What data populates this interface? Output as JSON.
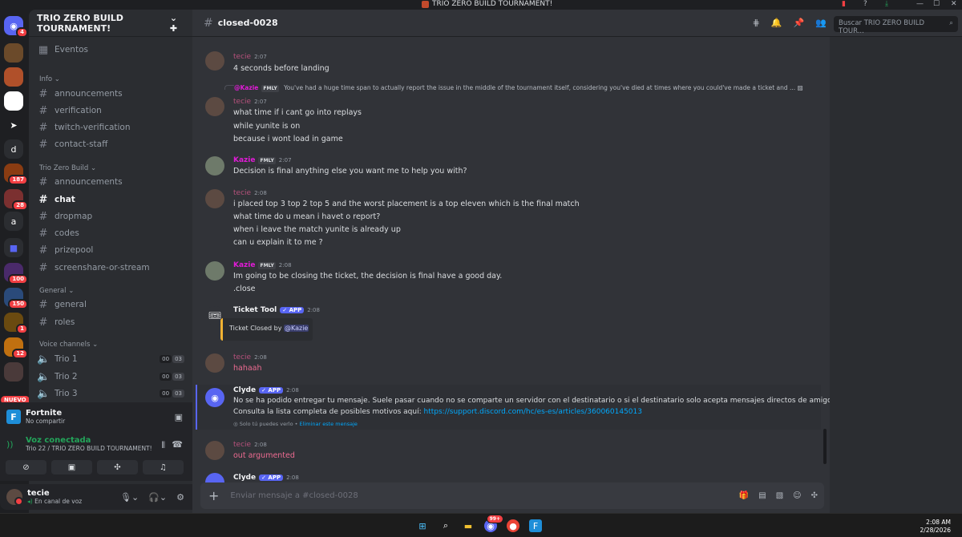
{
  "window": {
    "title": "TRIO ZERO BUILD TOURNAMENT!"
  },
  "rail": {
    "badges": [
      "4",
      "",
      "",
      "",
      "",
      "187",
      "28",
      "",
      "",
      "100",
      "150",
      "1",
      "12",
      "",
      "18"
    ],
    "letters": {
      "d": "d",
      "a": "a"
    },
    "nuevo": "NUEVO"
  },
  "sidebar": {
    "guild_name": "TRIO ZERO BUILD TOURNAMENT!",
    "events_label": "Eventos",
    "categories": {
      "info": "Info",
      "trio_zero_build": "Trio Zero Build",
      "general": "General",
      "voice_channels": "Voice channels"
    },
    "info_channels": [
      "announcements",
      "verification",
      "twitch-verification",
      "contact-staff"
    ],
    "tzb_channels": [
      "announcements",
      "chat",
      "dropmap",
      "codes",
      "prizepool",
      "screenshare-or-stream"
    ],
    "general_channels": [
      "general",
      "roles"
    ],
    "voice_channels": [
      {
        "name": "Trio 1",
        "a": "00",
        "b": "03"
      },
      {
        "name": "Trio 2",
        "a": "00",
        "b": "03"
      },
      {
        "name": "Trio 3",
        "a": "00",
        "b": "03"
      }
    ]
  },
  "activity": {
    "title": "Fortnite",
    "subtitle": "No compartir"
  },
  "voice": {
    "status": "Voz conectada",
    "channel": "Trio 22 / TRIO ZERO BUILD TOURNAMENT!"
  },
  "user": {
    "name": "tecie",
    "status": "En canal de voz"
  },
  "header": {
    "channel_name": "closed-0028",
    "search_placeholder": "Buscar TRIO ZERO BUILD TOUR..."
  },
  "messages": {
    "m1": {
      "author": "tecie",
      "time": "2:07",
      "lines": [
        "4 seconds before landing"
      ]
    },
    "reply": {
      "author": "@Kazie",
      "tag": "FMLY",
      "text": "You've had a huge time span to actually report the issue in the middle of the tournament itself, considering you've died at times where you could've made a ticket and ..."
    },
    "m2": {
      "author": "tecie",
      "time": "2:07",
      "lines": [
        "what time if i cant go into replays",
        "while yunite is on",
        "because i wont load in game"
      ]
    },
    "m3": {
      "author": "Kazie",
      "tag": "FMLY",
      "time": "2:07",
      "lines": [
        "Decision is final anything else you want me to help you with?"
      ]
    },
    "m4": {
      "author": "tecie",
      "time": "2:08",
      "lines": [
        "i placed top 3 top 2 top 5 and the worst placement is a top eleven which is the final match",
        "what time do u mean i havet o report?",
        "when i leave  the match yunite is already up",
        "can u explain it to me ?"
      ]
    },
    "m5": {
      "author": "Kazie",
      "tag": "FMLY",
      "time": "2:08",
      "lines": [
        "Im going to be closing the ticket, the decision is final have a good day.",
        ".close"
      ]
    },
    "m6": {
      "author": "Ticket Tool",
      "tag": "APP",
      "time": "2:08",
      "embed_prefix": "Ticket Closed by",
      "embed_mention": "@Kazie"
    },
    "m7": {
      "author": "tecie",
      "time": "2:08",
      "lines": [
        "hahaah"
      ]
    },
    "m8": {
      "author": "Clyde",
      "tag": "APP",
      "time": "2:08",
      "line1": "No se ha podido entregar tu mensaje. Suele pasar cuando no se comparte un servidor con el destinatario o si el destinatario solo acepta mensajes directos de amigos.",
      "line2_prefix": "Consulta la lista completa de posibles motivos aquí:",
      "link": "https://support.discord.com/hc/es-es/articles/360060145013",
      "ephemeral": "Solo tú puedes verlo •",
      "dismiss": "Eliminar este mensaje"
    },
    "m9": {
      "author": "tecie",
      "time": "2:08",
      "lines": [
        "out argumented"
      ]
    },
    "m10": {
      "author": "Clyde",
      "tag": "APP",
      "time": "2:08"
    }
  },
  "composer": {
    "placeholder": "Enviar mensaje a #closed-0028"
  },
  "taskbar": {
    "time": "2:08 AM",
    "date": "2/28/2026",
    "discord_badge": "99+"
  },
  "colors": {
    "accent": "#5865f2",
    "online": "#23a55a",
    "danger": "#f23f43",
    "kazie": "#e01bd6",
    "tecie": "#b5517b"
  }
}
